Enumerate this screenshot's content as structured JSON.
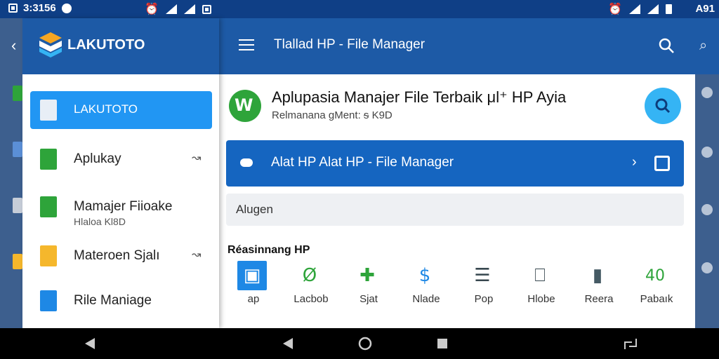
{
  "status_bar": {
    "time_left": "3:3156",
    "time_right": "A91"
  },
  "app_bar": {
    "title": "Tlallad HP - File Manager"
  },
  "drawer": {
    "app_name": "LAKUTOTO",
    "items": [
      {
        "label": "LAKUTOTO",
        "selected": true
      },
      {
        "label": "Aplukay",
        "has_chevron": true
      },
      {
        "label": "Mamajer Fiioake",
        "sub": "Hlaloa  Kl8D"
      },
      {
        "label": "Materoen Sjalı",
        "has_chevron": true
      },
      {
        "label": "Rile Maniage"
      }
    ]
  },
  "hero": {
    "title": "Aplupasia Manajer File Terbaik μl⁺ HP Ayia",
    "subtitle": "Relmanana gMent: ᵴ K9D"
  },
  "banner": {
    "label": "Alat HP Alat HP - File Manager"
  },
  "search": {
    "placeholder": "Alugen"
  },
  "section": {
    "title": "Réasinnang HP",
    "items": [
      {
        "label": "ap",
        "icon": "file-manager-icon",
        "color": "#1e88e5"
      },
      {
        "label": "Lacbob",
        "icon": "sync-icon",
        "color": "#2ea43a"
      },
      {
        "label": "Sjat",
        "icon": "add-box-icon",
        "color": "#2ea43a"
      },
      {
        "label": "Nlade",
        "icon": "dollar-icon",
        "color": "#1e88e5"
      },
      {
        "label": "Pop",
        "icon": "document-icon",
        "color": "#37474f"
      },
      {
        "label": "Hlobe",
        "icon": "phone-icon",
        "color": "#37474f"
      },
      {
        "label": "Reera",
        "icon": "bookmark-icon",
        "color": "#455a64"
      },
      {
        "label": "Pabaık",
        "icon": "40",
        "color": "#2ea43a"
      }
    ]
  }
}
